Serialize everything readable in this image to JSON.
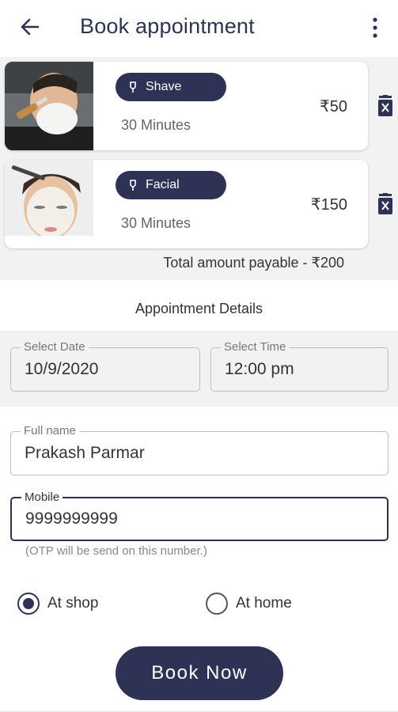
{
  "header": {
    "title": "Book appointment"
  },
  "services": [
    {
      "name": "Shave",
      "duration": "30 Minutes",
      "price": "₹50"
    },
    {
      "name": "Facial",
      "duration": "30 Minutes",
      "price": "₹150"
    }
  ],
  "total": "Total amount payable - ₹200",
  "details": {
    "heading": "Appointment Details",
    "date_label": "Select Date",
    "date_value": "10/9/2020",
    "time_label": "Select Time",
    "time_value": "12:00 pm"
  },
  "form": {
    "name_label": "Full name",
    "name_value": "Prakash Parmar",
    "mobile_label": "Mobile",
    "mobile_value": "9999999999",
    "mobile_hint": "(OTP will be send on this number.)"
  },
  "location": {
    "options": [
      "At shop",
      "At home"
    ],
    "selected": "At shop"
  },
  "actions": {
    "book_label": "Book Now"
  },
  "colors": {
    "primary": "#2e3356",
    "background": "#f2f2f2"
  }
}
